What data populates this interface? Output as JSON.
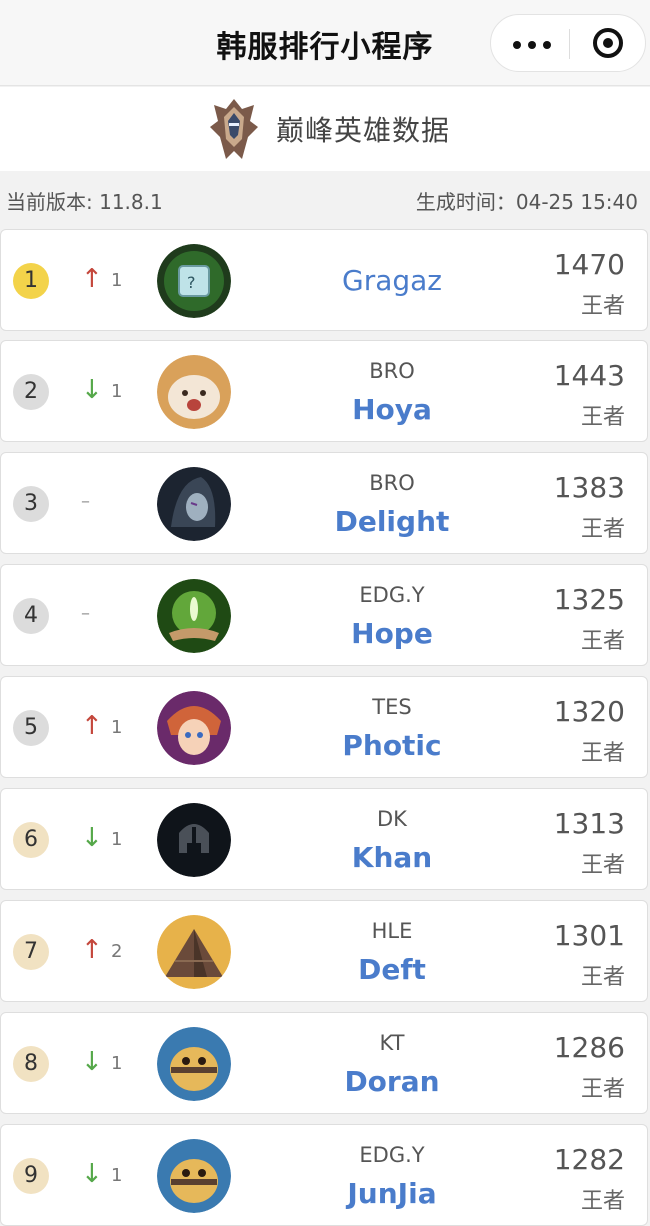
{
  "navbar": {
    "title": "韩服排行小程序"
  },
  "header": {
    "title": "巅峰英雄数据"
  },
  "meta": {
    "version": "当前版本: 11.8.1",
    "generated": "生成时间：04-25 15:40"
  },
  "players": [
    {
      "rank": "1",
      "trend": "↑",
      "trend_value": "1",
      "team": "",
      "name": "Gragaz",
      "score": "1470",
      "tier": "王者"
    },
    {
      "rank": "2",
      "trend": "↓",
      "trend_value": "1",
      "team": "BRO",
      "name": "Hoya",
      "score": "1443",
      "tier": "王者"
    },
    {
      "rank": "3",
      "trend": "–",
      "trend_value": "",
      "team": "BRO",
      "name": "Delight",
      "score": "1383",
      "tier": "王者"
    },
    {
      "rank": "4",
      "trend": "–",
      "trend_value": "",
      "team": "EDG.Y",
      "name": "Hope",
      "score": "1325",
      "tier": "王者"
    },
    {
      "rank": "5",
      "trend": "↑",
      "trend_value": "1",
      "team": "TES",
      "name": "Photic",
      "score": "1320",
      "tier": "王者"
    },
    {
      "rank": "6",
      "trend": "↓",
      "trend_value": "1",
      "team": "DK",
      "name": "Khan",
      "score": "1313",
      "tier": "王者"
    },
    {
      "rank": "7",
      "trend": "↑",
      "trend_value": "2",
      "team": "HLE",
      "name": "Deft",
      "score": "1301",
      "tier": "王者"
    },
    {
      "rank": "8",
      "trend": "↓",
      "trend_value": "1",
      "team": "KT",
      "name": "Doran",
      "score": "1286",
      "tier": "王者"
    },
    {
      "rank": "9",
      "trend": "↓",
      "trend_value": "1",
      "team": "EDG.Y",
      "name": "JunJia",
      "score": "1282",
      "tier": "王者"
    }
  ],
  "colors": {
    "player_name": "#4a7ccb",
    "trend_up": "#c4473c",
    "trend_down": "#55a84a",
    "rank_gold": "#f3d34a",
    "rank_gray": "#dcdcdc",
    "rank_tan": "#f1e2c2"
  },
  "icons": {
    "capsule_more": "more-dots-icon",
    "capsule_close": "target-circle-icon",
    "header": "challenger-emblem-icon",
    "avatars": [
      "mystery-box-avatar",
      "poro-avatar",
      "dark-hood-avatar",
      "spirit-hand-avatar",
      "jester-girl-avatar",
      "helmet-avatar",
      "pyramid-avatar",
      "bee-mascot-avatar",
      "bee-mascot-avatar"
    ]
  }
}
